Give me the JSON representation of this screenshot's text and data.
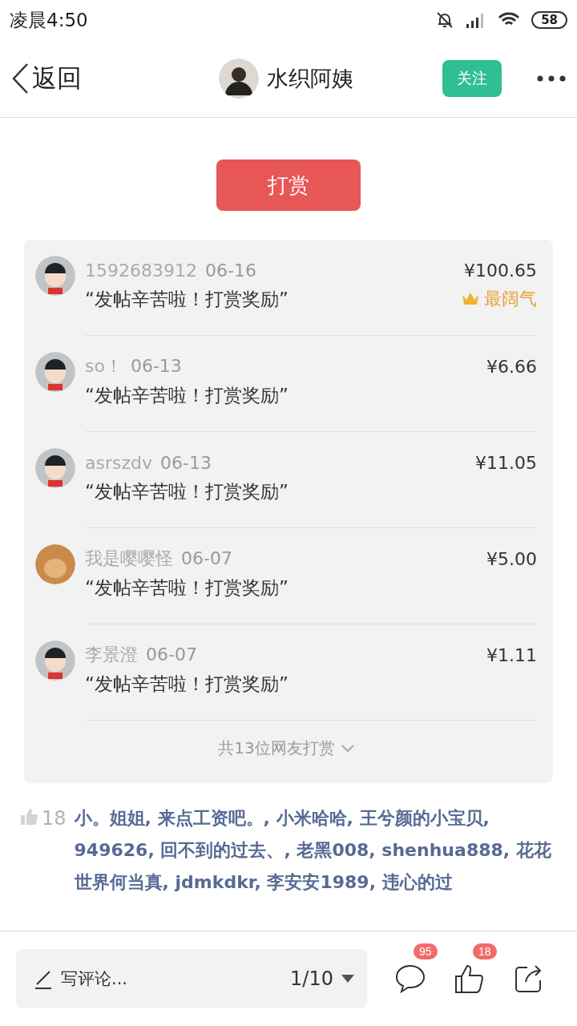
{
  "status_bar": {
    "time": "凌晨4:50",
    "battery": "58"
  },
  "header": {
    "back": "返回",
    "author": "水织阿姨",
    "follow": "关注",
    "followed": false
  },
  "reward_button": "打赏",
  "rewards": [
    {
      "name": "1592683912",
      "date": "06-16",
      "amount": "¥100.65",
      "message": "“发帖辛苦啦！打赏奖励”",
      "top_badge": "最阔气",
      "kind": "cartoon"
    },
    {
      "name": "so！",
      "date": "06-13",
      "amount": "¥6.66",
      "message": "“发帖辛苦啦！打赏奖励”",
      "kind": "cartoon"
    },
    {
      "name": "asrszdv",
      "date": "06-13",
      "amount": "¥11.05",
      "message": "“发帖辛苦啦！打赏奖励”",
      "kind": "cartoon"
    },
    {
      "name": "我是嘤嘤怪",
      "date": "06-07",
      "amount": "¥5.00",
      "message": "“发帖辛苦啦！打赏奖励”",
      "kind": "dog"
    },
    {
      "name": "李景澄",
      "date": "06-07",
      "amount": "¥1.11",
      "message": "“发帖辛苦啦！打赏奖励”",
      "kind": "cartoon"
    }
  ],
  "rewards_more": "共13位网友打赏",
  "likes": {
    "count": "18",
    "names": "小。姐姐, 来点工资吧。, 小米哈哈, 王兮颜的小宝贝, 949626, 回不到的过去、, 老黑008, shenhua888, 花花世界何当真, jdmkdkr, 李安安1989, 违心的过"
  },
  "bottom_bar": {
    "comment_placeholder": "写评论...",
    "page": "1/10",
    "comments_badge": "95",
    "likes_badge": "18"
  }
}
